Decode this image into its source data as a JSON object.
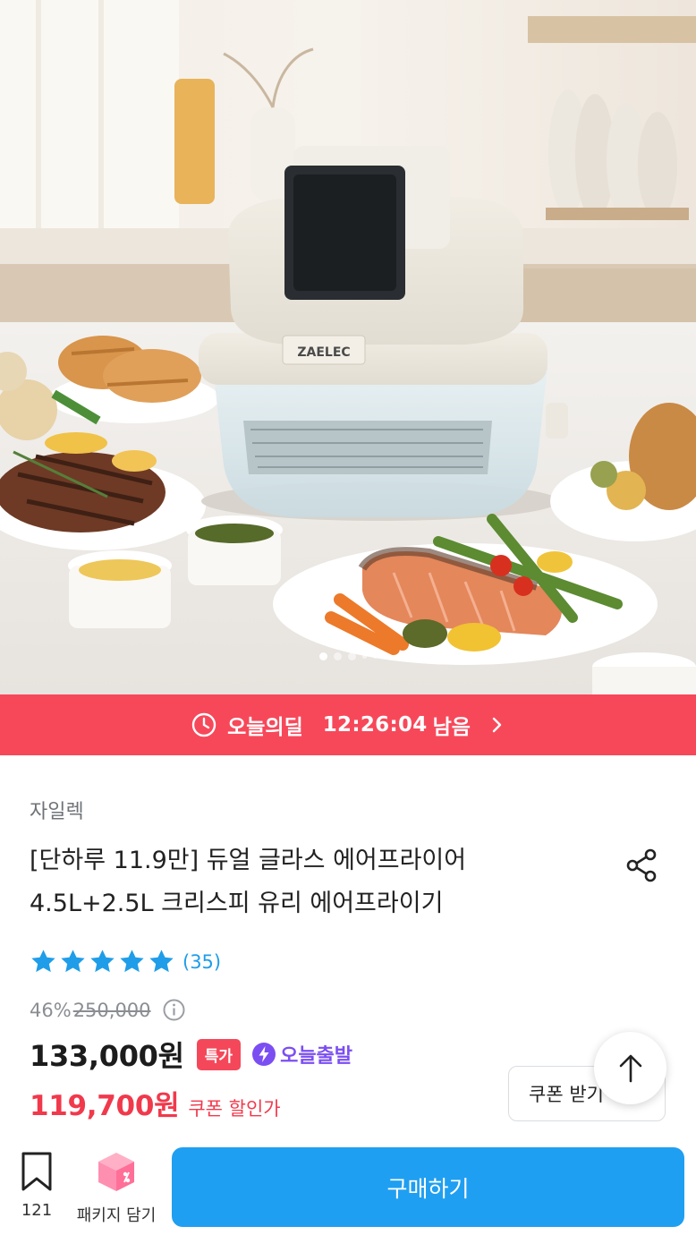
{
  "hero": {
    "appliance_brand": "ZAELEC",
    "carousel_total": 5,
    "carousel_active": 0
  },
  "deal_bar": {
    "label": "오늘의딜",
    "time_left": "12:26:04",
    "suffix": "남음",
    "icon": "clock-icon",
    "background": "#f7485a"
  },
  "product": {
    "brand": "자일렉",
    "title_line1": "[단하루 11.9만] 듀얼 글라스 에어프라이어",
    "title_line2": "4.5L+2.5L 크리스피 유리 에어프라이기",
    "rating": {
      "stars": 5,
      "max": 5,
      "review_count": "(35)",
      "color": "#1f9de8"
    },
    "discount_rate": "46%",
    "original_price": "250,000",
    "sale_price": "133,000원",
    "badge_special": "특가",
    "badge_today": "오늘출발",
    "coupon_price": "119,700원",
    "coupon_label": "쿠폰 할인가"
  },
  "coupon_button": {
    "label": "쿠폰 받기"
  },
  "bottom_bar": {
    "bookmark_count": "121",
    "package_label": "패키지 담기",
    "buy_label": "구매하기",
    "buy_color": "#1f9ff1"
  }
}
